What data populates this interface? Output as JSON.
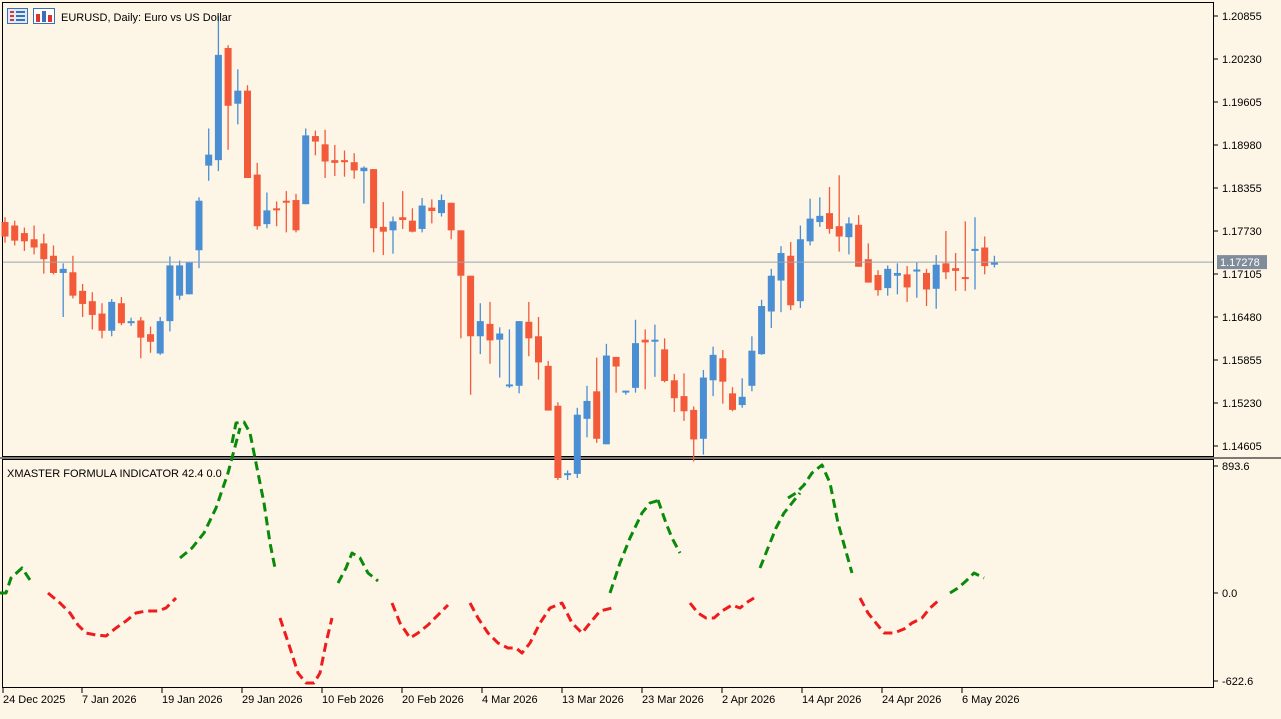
{
  "header": {
    "symbol": "EURUSD",
    "timeframe": "Daily",
    "description": "Euro vs US Dollar",
    "title_text": "EURUSD, Daily:  Euro vs US Dollar",
    "icons": [
      "menu-list-icon",
      "chart-bars-icon"
    ]
  },
  "colors": {
    "background": "#fdf5e6",
    "bull": "#4a8fd4",
    "bear": "#f25a3a",
    "bull_wick": "#4a8fd4",
    "bear_wick": "#f25a3a",
    "price_line": "#9aa3ad",
    "price_label_bg": "#7f8c99",
    "indicator_up": "#0a8a0a",
    "indicator_down": "#ee1c1c",
    "axis": "#000000"
  },
  "chart_data": [
    {
      "type": "candlestick",
      "title": "EURUSD, Daily:  Euro vs US Dollar",
      "y_ticks": [
        "1.20855",
        "1.20230",
        "1.19605",
        "1.18980",
        "1.18355",
        "1.17730",
        "1.17105",
        "1.16480",
        "1.15855",
        "1.15230",
        "1.14605"
      ],
      "ylim": [
        1.1411,
        1.2114
      ],
      "current_price": "1.17278",
      "current_price_value": 1.17278,
      "x_labels": [
        "24 Dec 2025",
        "7 Jan 2026",
        "19 Jan 2026",
        "29 Jan 2026",
        "10 Feb 2026",
        "20 Feb 2026",
        "4 Mar 2026",
        "13 Mar 2026",
        "23 Mar 2026",
        "2 Apr 2026",
        "14 Apr 2026",
        "24 Apr 2026",
        "6 May 2026"
      ],
      "grid": false,
      "candles": [
        [
          1.1786,
          1.1793,
          1.1756,
          1.1765
        ],
        [
          1.1781,
          1.1788,
          1.1752,
          1.1759
        ],
        [
          1.177,
          1.1778,
          1.1744,
          1.1758
        ],
        [
          1.1761,
          1.1781,
          1.1739,
          1.1749
        ],
        [
          1.1755,
          1.1769,
          1.1711,
          1.1732
        ],
        [
          1.1737,
          1.1752,
          1.171,
          1.1712
        ],
        [
          1.1712,
          1.1726,
          1.1648,
          1.1718
        ],
        [
          1.1713,
          1.1737,
          1.1675,
          1.1679
        ],
        [
          1.1686,
          1.1696,
          1.1648,
          1.1667
        ],
        [
          1.1671,
          1.1684,
          1.163,
          1.1651
        ],
        [
          1.1653,
          1.1668,
          1.1617,
          1.1628
        ],
        [
          1.1628,
          1.1674,
          1.162,
          1.167
        ],
        [
          1.1668,
          1.1677,
          1.1636,
          1.1639
        ],
        [
          1.1639,
          1.1647,
          1.1635,
          1.1642
        ],
        [
          1.1643,
          1.1648,
          1.1588,
          1.1618
        ],
        [
          1.1623,
          1.1634,
          1.1596,
          1.1612
        ],
        [
          1.1595,
          1.1648,
          1.1593,
          1.1642
        ],
        [
          1.1642,
          1.1736,
          1.1627,
          1.1723
        ],
        [
          1.1679,
          1.173,
          1.1673,
          1.1723
        ],
        [
          1.1681,
          1.1726,
          1.1681,
          1.1728
        ],
        [
          1.1745,
          1.1822,
          1.1719,
          1.1817
        ],
        [
          1.1868,
          1.1922,
          1.1846,
          1.1884
        ],
        [
          1.1876,
          1.2086,
          1.186,
          1.2029
        ],
        [
          1.2039,
          1.2043,
          1.1891,
          1.1955
        ],
        [
          1.1958,
          1.2008,
          1.1928,
          1.1977
        ],
        [
          1.1977,
          1.1985,
          1.185,
          1.185
        ],
        [
          1.1855,
          1.1872,
          1.1775,
          1.178
        ],
        [
          1.1783,
          1.1829,
          1.1777,
          1.1803
        ],
        [
          1.1806,
          1.1816,
          1.178,
          1.1803
        ],
        [
          1.1817,
          1.1831,
          1.1771,
          1.1815
        ],
        [
          1.1818,
          1.1827,
          1.1771,
          1.1774
        ],
        [
          1.1812,
          1.1922,
          1.1812,
          1.1912
        ],
        [
          1.1911,
          1.1919,
          1.1883,
          1.1903
        ],
        [
          1.1899,
          1.192,
          1.185,
          1.1874
        ],
        [
          1.1876,
          1.1898,
          1.1853,
          1.1872
        ],
        [
          1.1876,
          1.189,
          1.1852,
          1.1873
        ],
        [
          1.1873,
          1.1886,
          1.1849,
          1.1861
        ],
        [
          1.186,
          1.1867,
          1.1813,
          1.1865
        ],
        [
          1.1863,
          1.1863,
          1.1742,
          1.1777
        ],
        [
          1.1779,
          1.1815,
          1.1738,
          1.1772
        ],
        [
          1.1774,
          1.1794,
          1.174,
          1.1787
        ],
        [
          1.1793,
          1.1831,
          1.1776,
          1.1789
        ],
        [
          1.1788,
          1.1806,
          1.1771,
          1.1772
        ],
        [
          1.1776,
          1.1821,
          1.1771,
          1.181
        ],
        [
          1.1807,
          1.1819,
          1.1784,
          1.1802
        ],
        [
          1.1799,
          1.1826,
          1.1794,
          1.1818
        ],
        [
          1.1814,
          1.1797,
          1.1761,
          1.1774
        ],
        [
          1.1774,
          1.1694,
          1.1617,
          1.1708
        ],
        [
          1.1708,
          1.1688,
          1.1535,
          1.162
        ],
        [
          1.162,
          1.1668,
          1.1594,
          1.1642
        ],
        [
          1.1638,
          1.167,
          1.158,
          1.1614
        ],
        [
          1.1615,
          1.1633,
          1.156,
          1.1624
        ],
        [
          1.1548,
          1.163,
          1.1545,
          1.155
        ],
        [
          1.1548,
          1.164,
          1.1537,
          1.1642
        ],
        [
          1.1641,
          1.167,
          1.1591,
          1.1617
        ],
        [
          1.162,
          1.1648,
          1.1557,
          1.1582
        ],
        [
          1.1577,
          1.1584,
          1.1513,
          1.1512
        ],
        [
          1.1519,
          1.1524,
          1.1411,
          1.1414
        ],
        [
          1.1419,
          1.1425,
          1.1411,
          1.1421
        ],
        [
          1.142,
          1.1516,
          1.1414,
          1.1506
        ],
        [
          1.15,
          1.1548,
          1.1473,
          1.1526
        ],
        [
          1.154,
          1.1589,
          1.1465,
          1.1471
        ],
        [
          1.1463,
          1.1609,
          1.1463,
          1.1592
        ],
        [
          1.159,
          1.1584,
          1.1538,
          1.1576
        ],
        [
          1.1541,
          1.154,
          1.1535,
          1.1541
        ],
        [
          1.1545,
          1.1644,
          1.1538,
          1.161
        ],
        [
          1.1615,
          1.163,
          1.1543,
          1.1611
        ],
        [
          1.1613,
          1.1637,
          1.1561,
          1.1615
        ],
        [
          1.1601,
          1.1617,
          1.1553,
          1.1555
        ],
        [
          1.1556,
          1.1565,
          1.151,
          1.153
        ],
        [
          1.1533,
          1.1566,
          1.1497,
          1.1511
        ],
        [
          1.1513,
          1.1518,
          1.1438,
          1.147
        ],
        [
          1.1471,
          1.1571,
          1.1448,
          1.156
        ],
        [
          1.1556,
          1.1605,
          1.1533,
          1.1593
        ],
        [
          1.1588,
          1.16,
          1.1522,
          1.1554
        ],
        [
          1.1537,
          1.1546,
          1.1511,
          1.1513
        ],
        [
          1.152,
          1.1559,
          1.1516,
          1.1532
        ],
        [
          1.1548,
          1.162,
          1.154,
          1.1599
        ],
        [
          1.1594,
          1.1673,
          1.1593,
          1.1664
        ],
        [
          1.1656,
          1.1718,
          1.1632,
          1.1708
        ],
        [
          1.1701,
          1.1751,
          1.1655,
          1.1741
        ],
        [
          1.1737,
          1.1757,
          1.1658,
          1.1665
        ],
        [
          1.1671,
          1.1781,
          1.1661,
          1.1761
        ],
        [
          1.1758,
          1.182,
          1.1752,
          1.1791
        ],
        [
          1.1786,
          1.1822,
          1.1779,
          1.1795
        ],
        [
          1.1799,
          1.1837,
          1.1769,
          1.1776
        ],
        [
          1.178,
          1.1854,
          1.1743,
          1.1765
        ],
        [
          1.1764,
          1.1793,
          1.1739,
          1.1784
        ],
        [
          1.1782,
          1.1796,
          1.1721,
          1.1721
        ],
        [
          1.1732,
          1.1755,
          1.1698,
          1.1698
        ],
        [
          1.1709,
          1.1716,
          1.1679,
          1.1687
        ],
        [
          1.169,
          1.1723,
          1.1679,
          1.1718
        ],
        [
          1.1708,
          1.1726,
          1.1681,
          1.1712
        ],
        [
          1.171,
          1.1722,
          1.167,
          1.1691
        ],
        [
          1.1715,
          1.1727,
          1.1676,
          1.1717
        ],
        [
          1.1712,
          1.1718,
          1.1664,
          1.1688
        ],
        [
          1.1689,
          1.1738,
          1.166,
          1.1724
        ],
        [
          1.1726,
          1.1773,
          1.1703,
          1.1713
        ],
        [
          1.1719,
          1.1741,
          1.1686,
          1.1715
        ],
        [
          1.1706,
          1.1787,
          1.1686,
          1.1704
        ],
        [
          1.1747,
          1.1793,
          1.1688,
          1.1747
        ],
        [
          1.1749,
          1.1765,
          1.171,
          1.1722
        ],
        [
          1.1724,
          1.1737,
          1.172,
          1.1728
        ]
      ]
    },
    {
      "type": "line",
      "title": "XMASTER FORMULA INDICATOR 42.4 0.0",
      "y_ticks": [
        "893.6",
        "0.0",
        "-622.6"
      ],
      "ylim": [
        -622.6,
        893.6
      ],
      "green_segments": [
        [
          [
            0,
            0
          ],
          [
            6,
            0
          ],
          [
            11,
            15
          ],
          [
            22,
            25
          ],
          [
            32,
            10
          ]
        ],
        [
          [
            180,
            35
          ],
          [
            192,
            45
          ],
          [
            204,
            60
          ],
          [
            216,
            85
          ],
          [
            228,
            120
          ],
          [
            240,
            165
          ]
        ],
        [
          [
            232,
            150
          ],
          [
            236,
            170
          ],
          [
            244,
            171
          ],
          [
            250,
            160
          ],
          [
            256,
            130
          ],
          [
            264,
            90
          ],
          [
            270,
            50
          ],
          [
            275,
            25
          ]
        ],
        [
          [
            338,
            10
          ],
          [
            346,
            25
          ],
          [
            352,
            40
          ],
          [
            360,
            35
          ],
          [
            368,
            20
          ],
          [
            378,
            12
          ]
        ],
        [
          [
            610,
            0
          ],
          [
            620,
            30
          ],
          [
            630,
            55
          ],
          [
            642,
            80
          ],
          [
            650,
            90
          ],
          [
            660,
            93
          ]
        ],
        [
          [
            658,
            93
          ],
          [
            666,
            70
          ],
          [
            672,
            55
          ],
          [
            680,
            40
          ]
        ],
        [
          [
            760,
            25
          ],
          [
            768,
            45
          ],
          [
            776,
            65
          ],
          [
            784,
            80
          ],
          [
            792,
            90
          ],
          [
            800,
            100
          ]
        ],
        [
          [
            788,
            95
          ],
          [
            796,
            100
          ],
          [
            804,
            108
          ],
          [
            812,
            120
          ],
          [
            822,
            128
          ],
          [
            830,
            110
          ],
          [
            838,
            70
          ],
          [
            852,
            20
          ]
        ],
        [
          [
            950,
            0
          ],
          [
            958,
            5
          ],
          [
            966,
            12
          ],
          [
            974,
            20
          ],
          [
            984,
            15
          ]
        ]
      ],
      "red_segments": [
        [
          [
            48,
            0
          ],
          [
            60,
            -10
          ],
          [
            70,
            -20
          ],
          [
            78,
            -32
          ],
          [
            86,
            -40
          ],
          [
            96,
            -42
          ],
          [
            106,
            -43
          ],
          [
            116,
            -35
          ],
          [
            126,
            -28
          ],
          [
            136,
            -20
          ],
          [
            146,
            -18
          ],
          [
            158,
            -18
          ],
          [
            166,
            -15
          ],
          [
            176,
            -5
          ]
        ],
        [
          [
            280,
            -25
          ],
          [
            290,
            -55
          ],
          [
            298,
            -80
          ],
          [
            306,
            -90
          ],
          [
            314,
            -90
          ],
          [
            320,
            -80
          ],
          [
            326,
            -50
          ],
          [
            332,
            -25
          ]
        ],
        [
          [
            392,
            -10
          ],
          [
            400,
            -30
          ],
          [
            410,
            -45
          ],
          [
            418,
            -40
          ],
          [
            428,
            -32
          ],
          [
            438,
            -22
          ],
          [
            448,
            -12
          ]
        ],
        [
          [
            470,
            -10
          ],
          [
            478,
            -25
          ],
          [
            488,
            -40
          ],
          [
            498,
            -50
          ],
          [
            508,
            -55
          ],
          [
            516,
            -55
          ],
          [
            522,
            -60
          ],
          [
            530,
            -50
          ],
          [
            540,
            -30
          ],
          [
            550,
            -15
          ],
          [
            562,
            -10
          ],
          [
            572,
            -30
          ],
          [
            582,
            -40
          ],
          [
            590,
            -30
          ],
          [
            600,
            -18
          ],
          [
            612,
            -15
          ]
        ],
        [
          [
            690,
            -10
          ],
          [
            698,
            -20
          ],
          [
            706,
            -25
          ],
          [
            714,
            -25
          ],
          [
            722,
            -18
          ],
          [
            732,
            -12
          ],
          [
            740,
            -15
          ],
          [
            746,
            -10
          ],
          [
            754,
            -5
          ]
        ],
        [
          [
            860,
            -5
          ],
          [
            868,
            -20
          ],
          [
            876,
            -30
          ],
          [
            884,
            -40
          ],
          [
            894,
            -40
          ],
          [
            904,
            -36
          ],
          [
            912,
            -30
          ],
          [
            922,
            -25
          ],
          [
            930,
            -15
          ],
          [
            938,
            -8
          ]
        ]
      ]
    }
  ]
}
